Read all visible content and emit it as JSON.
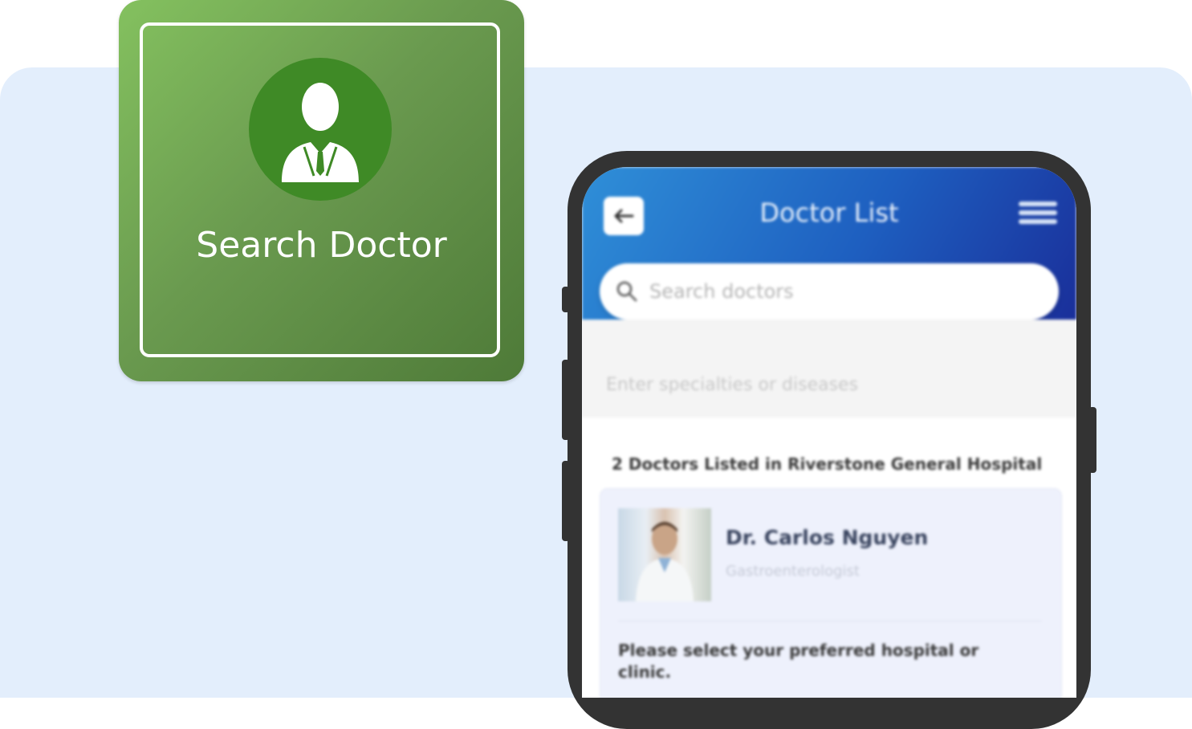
{
  "tile": {
    "label": "Search Doctor",
    "icon": "doctor-icon",
    "colors": {
      "gradient_start": "#84c15f",
      "gradient_end": "#4e7a38",
      "circle": "#3f8a26"
    }
  },
  "phone": {
    "header": {
      "title": "Doctor List",
      "back_icon": "arrow-left-icon",
      "menu_icon": "hamburger-menu-icon"
    },
    "search": {
      "placeholder": "Search doctors",
      "icon": "search-icon"
    },
    "specialty": {
      "placeholder": "Enter specialties or diseases"
    },
    "results": {
      "count_text": "2 Doctors Listed in Riverstone General Hospital",
      "doctors": [
        {
          "name": "Dr. Carlos Nguyen",
          "specialty": "Gastroenterologist"
        }
      ],
      "hospital_prompt": "Please select your preferred hospital or clinic."
    }
  },
  "colors": {
    "backdrop": "#e3eefc",
    "header_start": "#2f8fd8",
    "header_end": "#1a2f9a",
    "phone_frame": "#333333"
  }
}
